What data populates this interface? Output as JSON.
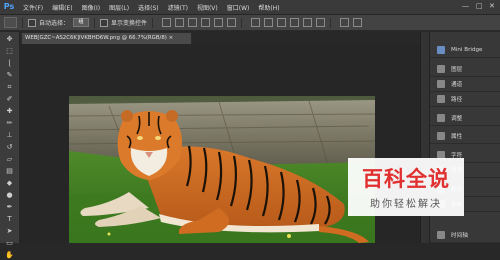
{
  "app": {
    "logo": "Ps"
  },
  "menu": [
    "文件(F)",
    "编辑(E)",
    "图像(I)",
    "图层(L)",
    "选择(S)",
    "滤镜(T)",
    "视图(V)",
    "窗口(W)",
    "帮助(H)"
  ],
  "window_controls": {
    "minimize": "—",
    "maximize": "□",
    "close": "✕"
  },
  "options_bar": {
    "auto_select_label": "自动选择：",
    "auto_select_value": "组",
    "show_transform_label": "显示变换控件"
  },
  "document": {
    "tab_title": "WEB[GZC~AS2C6K]IVKBHD6W.png @ 66.7%(RGB/8) ×"
  },
  "tools": [
    "move-icon",
    "marquee-icon",
    "lasso-icon",
    "quick-select-icon",
    "crop-icon",
    "eyedropper-icon",
    "healing-icon",
    "brush-icon",
    "stamp-icon",
    "history-brush-icon",
    "eraser-icon",
    "gradient-icon",
    "blur-icon",
    "dodge-icon",
    "pen-icon",
    "type-icon",
    "path-select-icon",
    "shape-icon",
    "hand-icon",
    "zoom-icon"
  ],
  "panels": {
    "mini_bridge": "Mini Bridge",
    "items": [
      {
        "label": "图层",
        "icon": "layers-icon"
      },
      {
        "label": "通道",
        "icon": "channels-icon"
      },
      {
        "label": "路径",
        "icon": "paths-icon"
      },
      {
        "label": "调整",
        "icon": "adjust-icon"
      },
      {
        "label": "属性",
        "icon": "properties-icon"
      },
      {
        "label": "字符",
        "icon": "character-icon"
      },
      {
        "label": "段落",
        "icon": "paragraph-icon"
      },
      {
        "label": "颜色",
        "icon": "color-icon"
      },
      {
        "label": "色板",
        "icon": "swatches-icon"
      },
      {
        "label": "时间轴",
        "icon": "timeline-icon"
      }
    ]
  },
  "watermark": {
    "title": "百科全说",
    "subtitle": "助你轻松解决"
  }
}
